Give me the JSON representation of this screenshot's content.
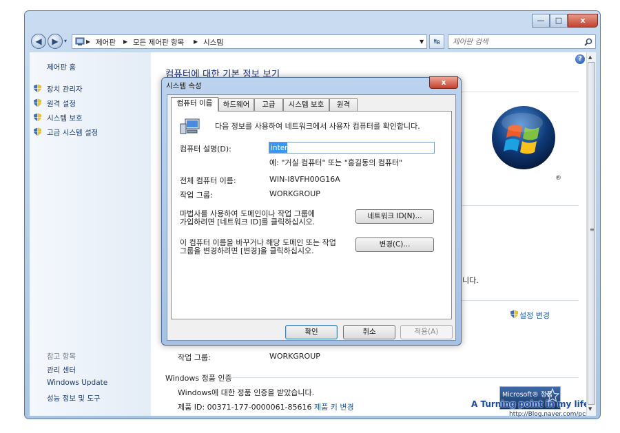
{
  "window": {
    "caption_min": "—",
    "caption_max": "□",
    "caption_close": "x",
    "nav": {
      "back": "◀",
      "forward": "▶",
      "breadcrumb": [
        "제어판",
        "모든 제어판 항목",
        "시스템"
      ],
      "search_placeholder": "제어판 검색"
    }
  },
  "left_pane": {
    "home": "제어판 홈",
    "tasks": [
      "장치 관리자",
      "원격 설정",
      "시스템 보호",
      "고급 시스템 설정"
    ],
    "see_also_title": "참고 항목",
    "see_also": [
      "관리 센터",
      "Windows Update",
      "성능 정보 및 도구"
    ]
  },
  "main": {
    "title": "컴퓨터에 대한 기본 정보 보기",
    "partial_text": "니다.",
    "change_settings": "설정 변경",
    "workgroup_label": "작업 그룹:",
    "workgroup_value": "WORKGROUP",
    "activation_header": "Windows 정품 인증",
    "activation_status": "Windows에 대한 정품 인증을 받았습니다.",
    "product_id": "제품 ID: 00371-177-0000061-85616",
    "change_key": "제품 키 변경",
    "genuine_badge": "Microsoft® 정품",
    "watermark": "A Turning point in my life",
    "watermark_url": "http://Blog.naver.com/pcset",
    "help": "?"
  },
  "dialog": {
    "title": "시스템 속성",
    "close": "x",
    "tabs": [
      "컴퓨터 이름",
      "하드웨어",
      "고급",
      "시스템 보호",
      "원격"
    ],
    "intro": "다음 정보를 사용하여 네트워크에서 사용자 컴퓨터를 확인합니다.",
    "desc_label": "컴퓨터 설명(D):",
    "desc_value": "inter",
    "desc_example": "예: \"거실 컴퓨터\" 또는 \"홍길동의 컴퓨터\"",
    "fullname_label": "전체 컴퓨터 이름:",
    "fullname_value": "WIN-I8VFH00G16A",
    "workgroup_label": "작업 그룹:",
    "workgroup_value": "WORKGROUP",
    "network_text_1": "마법사를 사용하여 도메인이나 작업 그룹에",
    "network_text_2": "가입하려면 [네트워크 ID]를 클릭하십시오.",
    "network_button": "네트워크 ID(N)...",
    "rename_text_1": "이 컴퓨터 이름을 바꾸거나 해당 도메인 또는 작업",
    "rename_text_2": "그룹을 변경하려면 [변경]을 클릭하십시오.",
    "change_button": "변경(C)...",
    "ok": "확인",
    "cancel": "취소",
    "apply": "적용(A)"
  }
}
